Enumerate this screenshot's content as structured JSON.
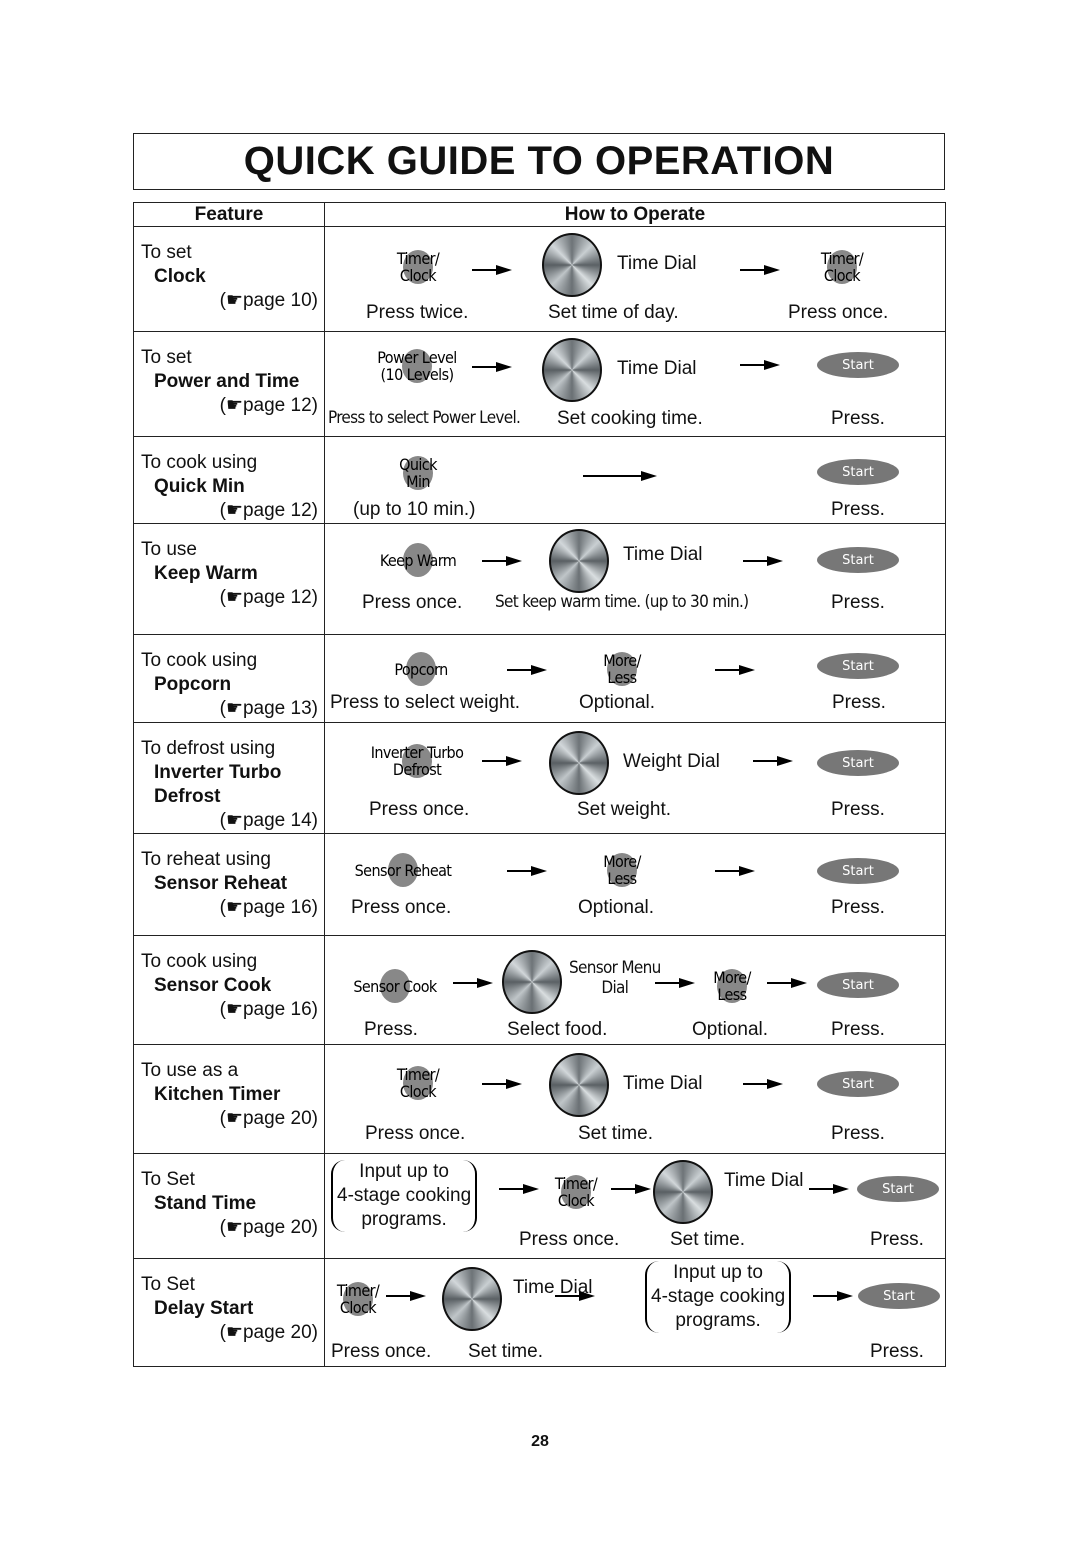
{
  "title": "QUICK GUIDE TO OPERATION",
  "headers": {
    "feature": "Feature",
    "how": "How to Operate"
  },
  "page_ref_icon": "pointing-hand-icon",
  "rows": [
    {
      "intro": "To set",
      "name": "Clock",
      "ref": "(☛page 10)",
      "steps": {
        "b1": "Timer/\nClock",
        "dial": "Time Dial",
        "b2": "Timer/\nClock",
        "c1": "Press twice.",
        "c2": "Set time of day.",
        "c3": "Press once."
      }
    },
    {
      "intro": "To set",
      "name": "Power and Time",
      "ref": "(☛page 12)",
      "steps": {
        "b1": "Power Level\n(10 Levels)",
        "dial": "Time Dial",
        "start": "Start",
        "c1": "Press to select Power Level.",
        "c2": "Set cooking time.",
        "c3": "Press."
      }
    },
    {
      "intro": "To cook using",
      "name": "Quick Min",
      "ref": "(☛page 12)",
      "steps": {
        "b1": "Quick\nMin",
        "start": "Start",
        "c1": "(up to 10 min.)",
        "c3": "Press."
      }
    },
    {
      "intro": "To use",
      "name": "Keep Warm",
      "ref": "(☛page 12)",
      "steps": {
        "b1": "Keep Warm",
        "dial": "Time Dial",
        "start": "Start",
        "c1": "Press once.",
        "c2": "Set keep warm time. (up to 30 min.)",
        "c3": "Press."
      }
    },
    {
      "intro": "To cook using",
      "name": "Popcorn",
      "ref": "(☛page 13)",
      "steps": {
        "b1": "Popcorn",
        "b2": "More/\nLess",
        "start": "Start",
        "c1": "Press to select weight.",
        "c2": "Optional.",
        "c3": "Press."
      }
    },
    {
      "intro": "To defrost using",
      "name": "Inverter Turbo\nDefrost",
      "ref": "(☛page 14)",
      "steps": {
        "b1": "Inverter Turbo\nDefrost",
        "dial": "Weight Dial",
        "start": "Start",
        "c1": "Press once.",
        "c2": "Set weight.",
        "c3": "Press."
      }
    },
    {
      "intro": "To reheat using",
      "name": "Sensor Reheat",
      "ref": "(☛page 16)",
      "steps": {
        "b1": "Sensor Reheat",
        "b2": "More/\nLess",
        "start": "Start",
        "c1": "Press once.",
        "c2": "Optional.",
        "c3": "Press."
      }
    },
    {
      "intro": "To cook using",
      "name": "Sensor Cook",
      "ref": "(☛page 16)",
      "steps": {
        "b1": "Sensor Cook",
        "dial": "Sensor Menu\nDial",
        "b2": "More/\nLess",
        "start": "Start",
        "c1": "Press.",
        "c2": "Select food.",
        "c3": "Optional.",
        "c4": "Press."
      }
    },
    {
      "intro": "To use as a",
      "name": "Kitchen Timer",
      "ref": "(☛page 20)",
      "steps": {
        "b1": "Timer/\nClock",
        "dial": "Time Dial",
        "start": "Start",
        "c1": "Press once.",
        "c2": "Set time.",
        "c3": "Press."
      }
    },
    {
      "intro": "To Set",
      "name": "Stand Time",
      "ref": "(☛page 20)",
      "steps": {
        "paren": "Input up to\n4-stage cooking\nprograms.",
        "b1": "Timer/\nClock",
        "dial": "Time Dial",
        "start": "Start",
        "c1": "Press once.",
        "c2": "Set time.",
        "c3": "Press."
      }
    },
    {
      "intro": "To Set",
      "name": "Delay Start",
      "ref": "(☛page 20)",
      "steps": {
        "b1": "Timer/\nClock",
        "dial": "Time Dial",
        "paren": "Input up to\n4-stage cooking\nprograms.",
        "start": "Start",
        "c1": "Press once.",
        "c2": "Set time.",
        "c3": "Press."
      }
    }
  ],
  "page_number": "28"
}
